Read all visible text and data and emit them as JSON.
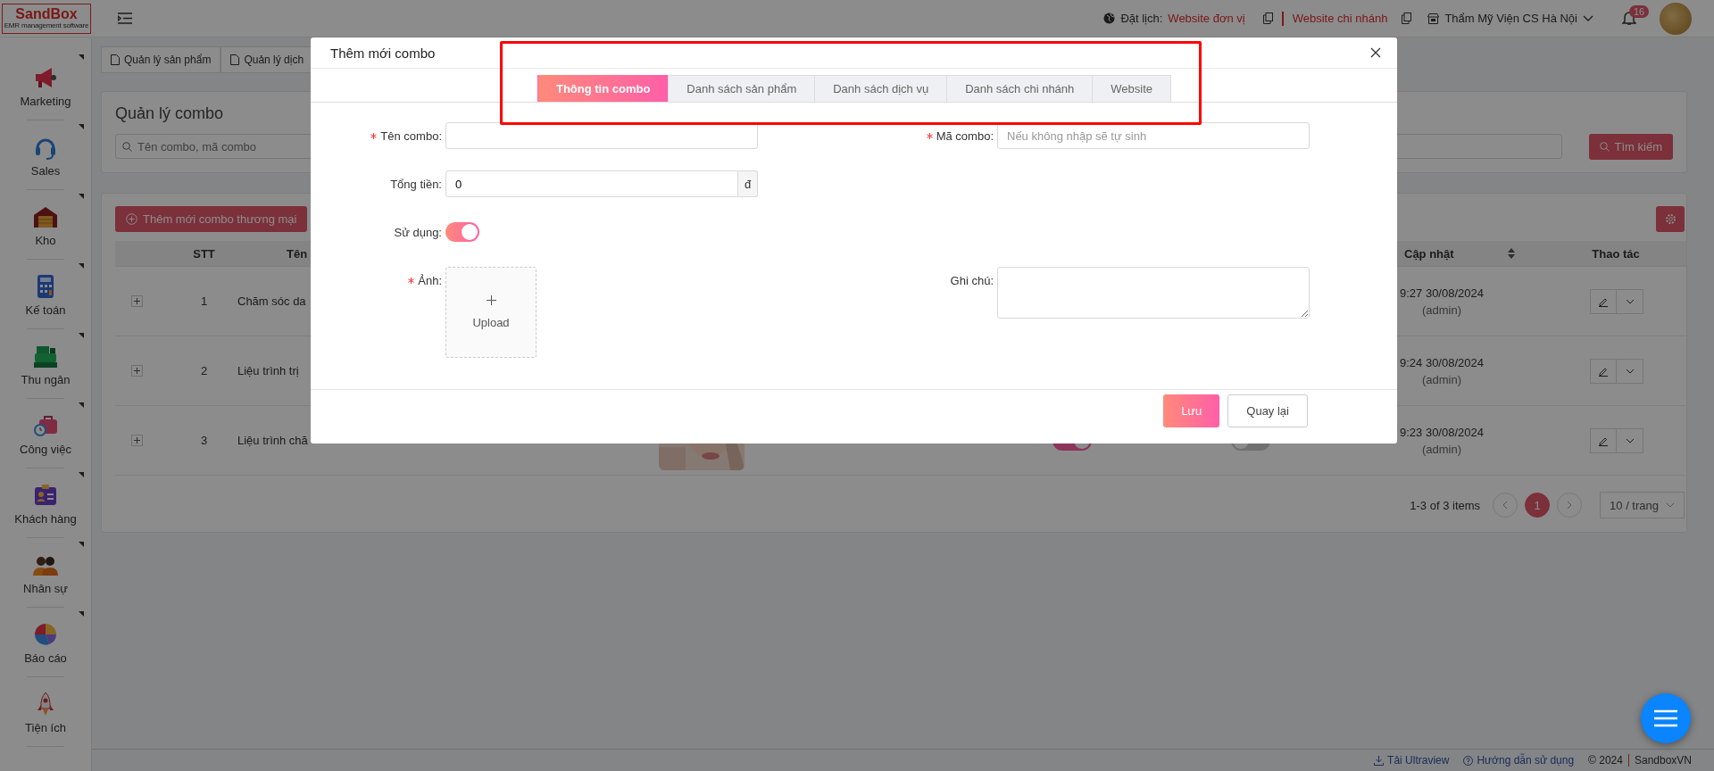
{
  "app": {
    "logo": "SandBox",
    "tagline": "EMR management software"
  },
  "topbar": {
    "booking_label": "Đặt lịch:",
    "links": [
      "Website đơn vị",
      "Website chi nhánh"
    ],
    "branch": "Thẩm Mỹ Viện CS Hà Nội",
    "notification_count": "16"
  },
  "sidebar": {
    "items": [
      {
        "label": "Marketing",
        "has_submenu": true
      },
      {
        "label": "Sales",
        "has_submenu": true
      },
      {
        "label": "Kho",
        "has_submenu": true
      },
      {
        "label": "Kế toán",
        "has_submenu": true
      },
      {
        "label": "Thu ngân",
        "has_submenu": true
      },
      {
        "label": "Công việc",
        "has_submenu": true
      },
      {
        "label": "Khách hàng",
        "has_submenu": true
      },
      {
        "label": "Nhân sự",
        "has_submenu": true
      },
      {
        "label": "Báo cáo",
        "has_submenu": true
      },
      {
        "label": "Tiện ích",
        "has_submenu": false
      }
    ]
  },
  "page_tabs": [
    {
      "label": "Quản lý sản phẩm"
    },
    {
      "label": "Quản lý dịch"
    }
  ],
  "page": {
    "title": "Quản lý combo",
    "search": {
      "placeholder": "Tên combo, mã combo"
    },
    "search_button": "Tìm kiếm",
    "add_button": "Thêm mới combo thương mại"
  },
  "table": {
    "columns": [
      "STT",
      "Tên",
      "Cập nhật",
      "Thao tác"
    ],
    "rows": [
      {
        "stt": "1",
        "name": "Chăm sóc da",
        "updated": "9:27 30/08/2024",
        "updated_by": "(admin)"
      },
      {
        "stt": "2",
        "name": "Liệu trình trị",
        "updated": "9:24 30/08/2024",
        "updated_by": "(admin)"
      },
      {
        "stt": "3",
        "name": "Liệu trình chă",
        "updated": "9:23 30/08/2024",
        "updated_by": "(admin)",
        "thumbnail": {
          "kind": "picture"
        },
        "toggles": [
          true,
          false
        ]
      }
    ]
  },
  "pagination": {
    "summary": "1-3 of 3 items",
    "pages": [
      {
        "label": "1",
        "selected": true
      }
    ],
    "page_size": "10 / trang"
  },
  "modal": {
    "title": "Thêm mới combo",
    "tabs": [
      {
        "label": "Thông tin combo",
        "selected": true
      },
      {
        "label": "Danh sách sản phẩm",
        "selected": false
      },
      {
        "label": "Danh sách dịch vụ",
        "selected": false
      },
      {
        "label": "Danh sách chi nhánh",
        "selected": false
      },
      {
        "label": "Website",
        "selected": false
      }
    ],
    "form_rows": [
      [
        {
          "kind": "text",
          "label": "Tên combo:",
          "required": true
        },
        {
          "kind": "text",
          "label": "Mã combo:",
          "required": true,
          "placeholder": "Nếu không nhập sẽ tự sinh"
        }
      ],
      [
        {
          "kind": "currency",
          "label": "Tổng tiền:",
          "required": false,
          "value": "0",
          "suffix": "đ"
        }
      ],
      [
        {
          "kind": "switch",
          "label": "Sử dụng:",
          "required": false,
          "on": true
        }
      ],
      [
        {
          "kind": "upload",
          "label": "Ảnh:",
          "required": true,
          "button_label": "Upload"
        },
        {
          "kind": "textarea",
          "label": "Ghi chú:",
          "required": false
        }
      ]
    ],
    "buttons": [
      {
        "label": "Lưu",
        "kind": "primary"
      },
      {
        "label": "Quay lại",
        "kind": "default"
      }
    ]
  },
  "annotation": {
    "kind": "highlight"
  },
  "footer": {
    "links": [
      "Tải Ultraview",
      "Hướng dẫn sử dụng"
    ],
    "copyright": "© 2024",
    "brand": "SandboxVN"
  }
}
